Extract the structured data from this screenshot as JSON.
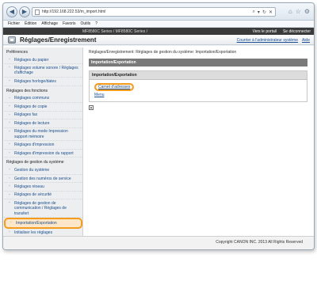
{
  "browser": {
    "url": "http://192.168.222.53/m_import.html",
    "back_glyph": "◀",
    "forward_glyph": "▶",
    "addr_icons": [
      "⌕",
      "▾",
      "↻",
      "✕"
    ],
    "right_icons": [
      "⌂",
      "☆",
      "⚙"
    ]
  },
  "menu": [
    "Fichier",
    "Édition",
    "Affichage",
    "Favoris",
    "Outils",
    "?"
  ],
  "app": {
    "model": "MF8580C Series / MF8580C Series /",
    "portal_link": "Vers le portail",
    "logout_link": "Se déconnecter",
    "title": "Réglages/Enregistrement",
    "mail_admin": "Courrier à l'administrateur système",
    "help": "Aide"
  },
  "sidebar": {
    "preferences_title": "Préférences",
    "preferences": [
      "Réglages du papier",
      "Réglages volume sonore / Réglages d'affichage",
      "Réglages horloge/dates"
    ],
    "functions_title": "Réglages des fonctions",
    "functions": [
      "Réglages communs",
      "Réglages de copie",
      "Réglages fax",
      "Réglages de lecture",
      "Réglages du mode Impression support mémoire",
      "Réglages d'impression",
      "Réglages d'impression du rapport"
    ],
    "management_title": "Réglages de gestion du système",
    "management": [
      "Gestion du système",
      "Gestion des numéros de service",
      "Réglages réseau",
      "Réglages de sécurité",
      "Réglages de gestion de communication / Réglages de transfert",
      "Importation/Exportation",
      "Initialiser les réglages"
    ]
  },
  "main": {
    "breadcrumb": "Réglages/Enregistrement: Réglages de gestion du système: Importation/Exportation",
    "section_title": "Importation/Exportation",
    "panel_title": "Importation/Exportation",
    "links": [
      "Carnet d'adresses",
      "Menu"
    ],
    "top_icon": "▲"
  },
  "footer": {
    "copyright": "Copyright CANON INC. 2013 All Rights Reserved"
  },
  "colors": {
    "highlight": "#f39c1e",
    "link": "#1a4f95",
    "header_dark": "#3a3a3a"
  }
}
